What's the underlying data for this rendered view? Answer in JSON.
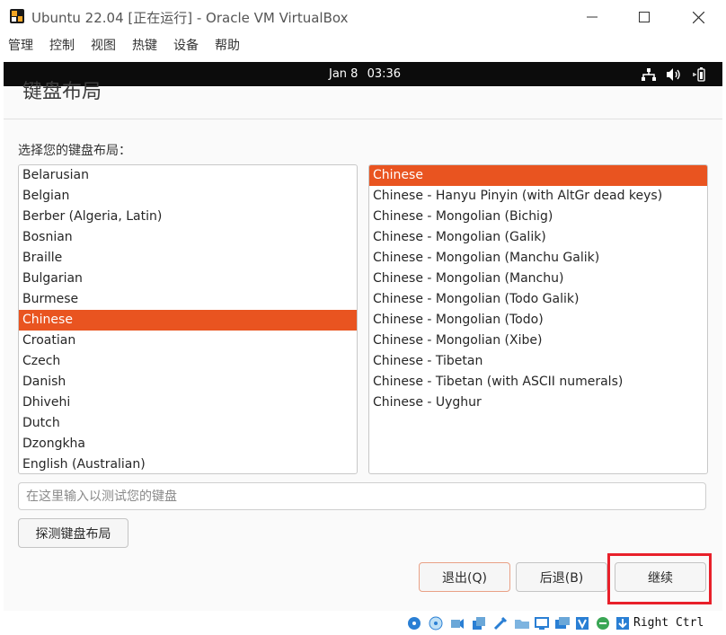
{
  "window": {
    "title": "Ubuntu 22.04 [正在运行] - Oracle VM VirtualBox"
  },
  "menu": [
    "管理",
    "控制",
    "视图",
    "热键",
    "设备",
    "帮助"
  ],
  "guest_topbar": {
    "date": "Jan 8",
    "time": "03:36",
    "tray_icons": [
      "network-icon",
      "speaker-icon",
      "battery-icon"
    ]
  },
  "installer": {
    "heading": "键盘布局",
    "prompt": "选择您的键盘布局：",
    "layouts": [
      "Belarusian",
      "Belgian",
      "Berber (Algeria, Latin)",
      "Bosnian",
      "Braille",
      "Bulgarian",
      "Burmese",
      "Chinese",
      "Croatian",
      "Czech",
      "Danish",
      "Dhivehi",
      "Dutch",
      "Dzongkha",
      "English (Australian)"
    ],
    "selected_layout": "Chinese",
    "variants": [
      "Chinese",
      "Chinese - Hanyu Pinyin (with AltGr dead keys)",
      "Chinese - Mongolian (Bichig)",
      "Chinese - Mongolian (Galik)",
      "Chinese - Mongolian (Manchu Galik)",
      "Chinese - Mongolian (Manchu)",
      "Chinese - Mongolian (Todo Galik)",
      "Chinese - Mongolian (Todo)",
      "Chinese - Mongolian (Xibe)",
      "Chinese - Tibetan",
      "Chinese - Tibetan (with ASCII numerals)",
      "Chinese - Uyghur"
    ],
    "selected_variant": "Chinese",
    "test_input": {
      "value": "",
      "placeholder": "在这里输入以测试您的键盘"
    },
    "detect_button": "探测键盘布局",
    "buttons": {
      "quit": "退出(Q)",
      "back": "后退(B)",
      "continue": "继续"
    }
  },
  "statusbar": {
    "host_key": "Right Ctrl"
  },
  "colors": {
    "accent": "#E95420",
    "highlight_box": "#E8202A"
  }
}
